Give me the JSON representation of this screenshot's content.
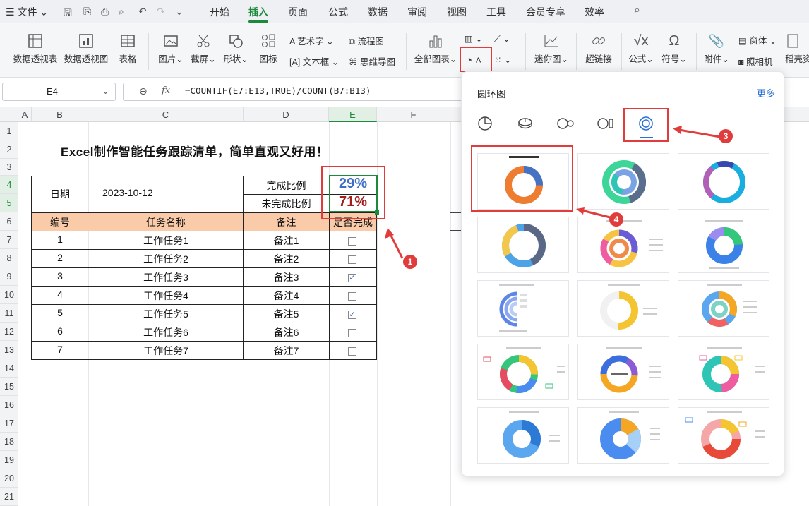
{
  "menu": {
    "file": "文件",
    "tabs": [
      "开始",
      "插入",
      "页面",
      "公式",
      "数据",
      "审阅",
      "视图",
      "工具",
      "会员专享",
      "效率"
    ]
  },
  "ribbon": {
    "pivot_table": "数据透视表",
    "pivot_view": "数据透视图",
    "table": "表格",
    "picture": "图片",
    "screenshot": "截屏",
    "shape": "形状",
    "icon": "图标",
    "art_text": "艺术字",
    "text_box": "文本框",
    "flowchart": "流程图",
    "mindmap": "思维导图",
    "all_charts": "全部图表",
    "sparkline": "迷你图",
    "hyperlink": "超链接",
    "formula": "公式",
    "symbol": "符号",
    "attachment": "附件",
    "window": "窗体",
    "camera": "照相机",
    "cut_text": "稻壳资"
  },
  "formula_bar": {
    "cell": "E4",
    "fx": "fx",
    "formula": "=COUNTIF(E7:E13,TRUE)/COUNT(B7:B13)"
  },
  "columns": [
    "A",
    "B",
    "C",
    "D",
    "E",
    "F"
  ],
  "rows": [
    "1",
    "2",
    "3",
    "4",
    "5",
    "6",
    "7",
    "8",
    "9",
    "10",
    "11",
    "12",
    "13",
    "14",
    "15",
    "16",
    "17",
    "18",
    "19",
    "20",
    "21"
  ],
  "sheet": {
    "title": "Excel制作智能任务跟踪清单，简单直观又好用！",
    "date_label": "日期",
    "date_value": "2023-10-12",
    "done_label": "完成比例",
    "done_value": "29%",
    "undone_label": "未完成比例",
    "undone_value": "71%",
    "headers": [
      "编号",
      "任务名称",
      "备注",
      "是否完成"
    ],
    "tasks": [
      {
        "no": "1",
        "name": "工作任务1",
        "note": "备注1",
        "done": false
      },
      {
        "no": "2",
        "name": "工作任务2",
        "note": "备注2",
        "done": false
      },
      {
        "no": "3",
        "name": "工作任务3",
        "note": "备注3",
        "done": true
      },
      {
        "no": "4",
        "name": "工作任务4",
        "note": "备注4",
        "done": false
      },
      {
        "no": "5",
        "name": "工作任务5",
        "note": "备注5",
        "done": true
      },
      {
        "no": "6",
        "name": "工作任务6",
        "note": "备注6",
        "done": false
      },
      {
        "no": "7",
        "name": "工作任务7",
        "note": "备注7",
        "done": false
      }
    ]
  },
  "panel": {
    "title": "圆环图",
    "more": "更多"
  },
  "annotations": [
    "1",
    "2",
    "3",
    "4"
  ],
  "colors": {
    "accent": "#1c8a3a",
    "annotation": "#e03c3c",
    "link": "#2a6fd6"
  }
}
